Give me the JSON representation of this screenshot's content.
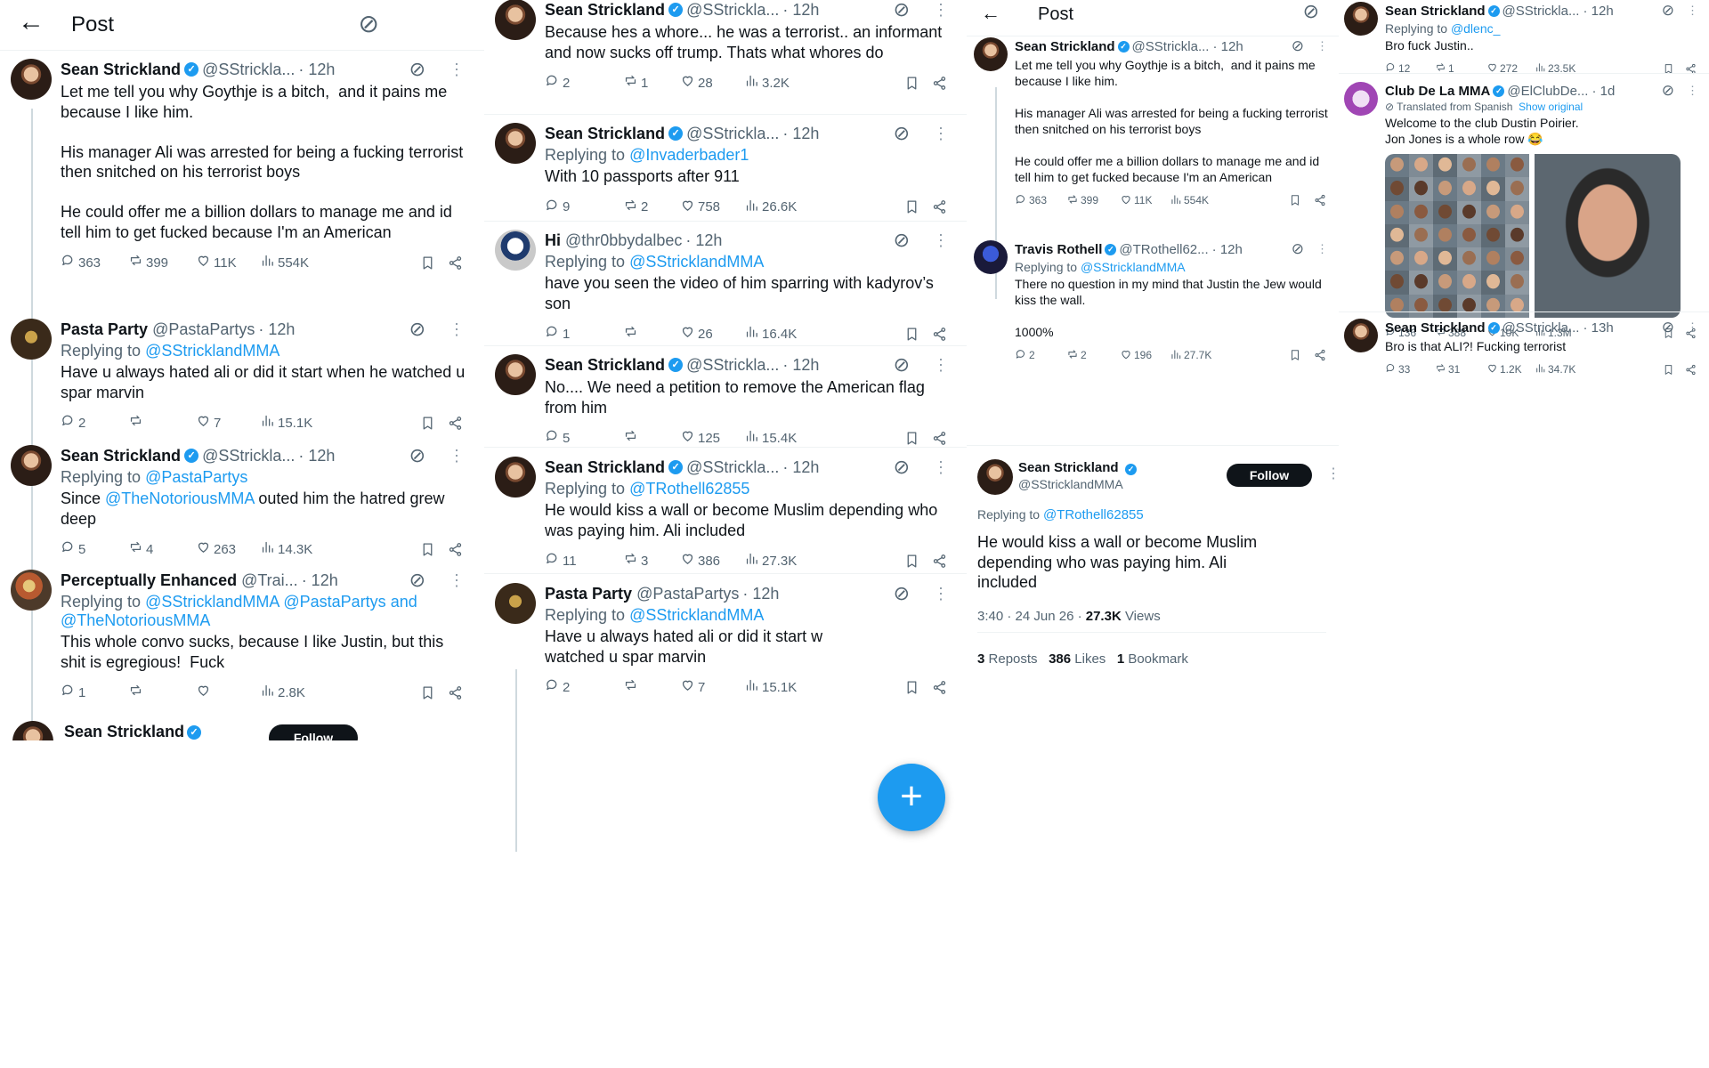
{
  "p1": {
    "header": {
      "back": "←",
      "title": "Post"
    },
    "tweets": [
      {
        "name": "Sean Strickland",
        "verified": true,
        "handle": "@SStrickla...",
        "time": "· 12h",
        "reply_to": "",
        "text": "Let me tell you why Goythje is a bitch,  and it pains me because I like him.\n\nHis manager Ali was arrested for being a fucking terrorist then snitched on his terrorist boys\n\nHe could offer me a billion dollars to manage me and id tell him to get fucked because I'm an American",
        "replies": "363",
        "reposts": "399",
        "likes": "11K",
        "views": "554K",
        "avatar": "sean"
      },
      {
        "name": "Pasta Party",
        "verified": false,
        "handle": "@PastaPartys",
        "time": "· 12h",
        "reply_to": "@SStricklandMMA",
        "text": "Have u always hated ali or did it start when he watched u spar marvin",
        "replies": "2",
        "reposts": "",
        "likes": "7",
        "views": "15.1K",
        "avatar": "pasta"
      },
      {
        "name": "Sean Strickland",
        "verified": true,
        "handle": "@SStrickla...",
        "time": "· 12h",
        "reply_to": "@PastaPartys",
        "text_pre": "Since ",
        "text_link": "@TheNotoriousMMA",
        "text_post": " outed him the hatred grew deep",
        "replies": "5",
        "reposts": "4",
        "likes": "263",
        "views": "14.3K",
        "avatar": "sean"
      },
      {
        "name": "Perceptually Enhanced",
        "verified": false,
        "handle": "@Trai...",
        "time": "· 12h",
        "reply_to": "@SStricklandMMA @PastaPartys and @TheNotoriousMMA",
        "text": "This whole convo sucks, because I like Justin, but this shit is egregious!  Fuck",
        "replies": "1",
        "reposts": "",
        "likes": "",
        "views": "2.8K",
        "avatar": "perc"
      }
    ],
    "partial": {
      "name": "Sean Strickland",
      "follow": "Follow"
    }
  },
  "p2": {
    "tweets": [
      {
        "name": "Sean Strickland",
        "handle": "@SStrickla...",
        "time": "· 12h",
        "reply_to": "",
        "text": "Because hes a whore... he was a terrorist.. an informant and now sucks off trump. Thats what whores do",
        "replies": "2",
        "reposts": "1",
        "likes": "28",
        "views": "3.2K",
        "avatar": "sean",
        "verified": true
      },
      {
        "name": "Sean Strickland",
        "handle": "@SStrickla...",
        "time": "· 12h",
        "reply_to": "@Invaderbader1",
        "text": "With 10 passports after 911",
        "replies": "9",
        "reposts": "2",
        "likes": "758",
        "views": "26.6K",
        "avatar": "sean",
        "verified": true
      },
      {
        "name": "Hi",
        "handle": "@thr0bbydalbec",
        "time": "· 12h",
        "reply_to": "@SStricklandMMA",
        "text": "have you seen the video of him sparring with kadyrov’s son",
        "replies": "1",
        "reposts": "",
        "likes": "26",
        "views": "16.4K",
        "avatar": "hi",
        "verified": false
      },
      {
        "name": "Sean Strickland",
        "handle": "@SStrickla...",
        "time": "· 12h",
        "reply_to": "",
        "text": "No.... We need a petition to remove the American flag from him",
        "replies": "5",
        "reposts": "",
        "likes": "125",
        "views": "15.4K",
        "avatar": "sean",
        "verified": true
      },
      {
        "name": "Sean Strickland",
        "handle": "@SStrickla...",
        "time": "· 12h",
        "reply_to": "@TRothell62855",
        "text": "He would kiss a wall or become Muslim depending who was paying him. Ali included",
        "replies": "11",
        "reposts": "3",
        "likes": "386",
        "views": "27.3K",
        "avatar": "sean",
        "verified": true
      },
      {
        "name": "Pasta Party",
        "handle": "@PastaPartys",
        "time": "· 12h",
        "reply_to": "@SStricklandMMA",
        "text": "Have u always hated ali or did it start w\nwatched u spar marvin",
        "replies": "2",
        "reposts": "",
        "likes": "7",
        "views": "15.1K",
        "avatar": "pasta",
        "verified": false
      }
    ],
    "fab": "+"
  },
  "p3": {
    "header": {
      "back": "←",
      "title": "Post"
    },
    "tweets": [
      {
        "name": "Sean Strickland",
        "verified": true,
        "handle": "@SStrickla...",
        "time": "· 12h",
        "reply_to": "",
        "text": "Let me tell you why Goythje is a bitch,  and it pains me because I like him.\n\nHis manager Ali was arrested for being a fucking terrorist then snitched on his terrorist boys\n\nHe could offer me a billion dollars to manage me and id tell him to get fucked because I'm an American",
        "replies": "363",
        "reposts": "399",
        "likes": "11K",
        "views": "554K",
        "avatar": "sean"
      },
      {
        "name": "Travis Rothell",
        "verified": true,
        "handle": "@TRothell62...",
        "time": "· 12h",
        "reply_to": "@SStricklandMMA",
        "text": "There no question in my mind that Justin the Jew would kiss the wall.\n\n1000%",
        "replies": "2",
        "reposts": "2",
        "likes": "196",
        "views": "27.7K",
        "avatar": "travis"
      }
    ],
    "main": {
      "name": "Sean Strickland",
      "handle": "@SStricklandMMA",
      "follow": "Follow",
      "reply_label": "Replying to ",
      "reply_to": "@TRothell62855",
      "text": "He would kiss a wall or become Muslim depending who was paying him. Ali included",
      "time": "3:40 · 24 Jun 26 · ",
      "views_count": "27.3K",
      "views_label": " Views",
      "reposts_count": "3",
      "reposts_label": "Reposts",
      "likes_count": "386",
      "likes_label": "Likes",
      "bookmark_count": "1",
      "bookmark_label": "Bookmark"
    }
  },
  "p4": {
    "tweets": [
      {
        "name": "Sean Strickland",
        "verified": true,
        "handle": "@SStrickla...",
        "time": "· 12h",
        "reply_to": "@dlenc_",
        "text": "Bro fuck Justin..",
        "replies": "12",
        "reposts": "1",
        "likes": "272",
        "views": "23.5K",
        "avatar": "sean"
      },
      {
        "name": "Club De La MMA",
        "verified": true,
        "handle": "@ElClubDe...",
        "time": "· 1d",
        "reply_to": "",
        "translated": "Translated from Spanish",
        "show_original": "Show original",
        "text": "Welcome to the club Dustin Poirier.\nJon Jones is a whole row 😂",
        "replies": "136",
        "reposts": "388",
        "likes": "10K",
        "views": "1.3M",
        "avatar": "club"
      },
      {
        "name": "Sean Strickland",
        "verified": true,
        "handle": "@SStrickla...",
        "time": "· 13h",
        "reply_to": "",
        "text": "Bro is that ALI?! Fucking terrorist",
        "replies": "33",
        "reposts": "31",
        "likes": "1.2K",
        "views": "34.7K",
        "avatar": "sean"
      }
    ]
  },
  "common": {
    "replying_to": "Replying to ",
    "verified_mark": "✓"
  },
  "icons": {
    "reply": "reply-icon",
    "repost": "repost-icon",
    "like": "heart-icon",
    "views": "views-icon",
    "bookmark": "bookmark-icon",
    "share": "share-icon",
    "grok": "grok-icon",
    "more": "more-icon"
  },
  "colors": {
    "accent": "#1d9bf0",
    "text": "#0f1419",
    "muted": "#536471",
    "line": "#cfd9de"
  }
}
